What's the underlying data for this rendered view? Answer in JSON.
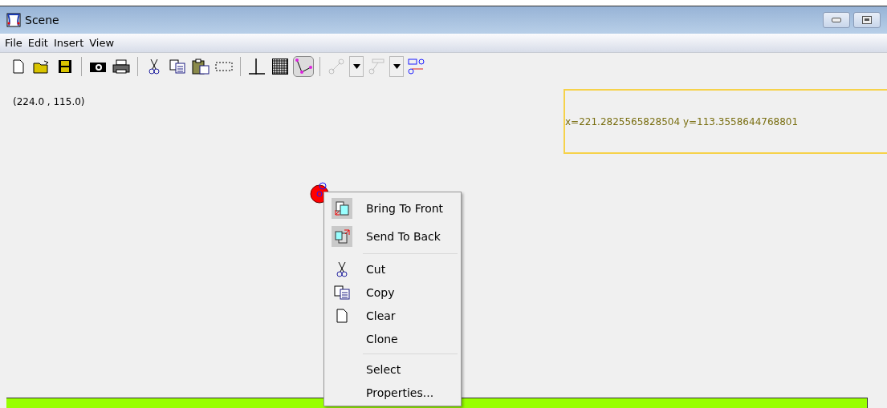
{
  "window": {
    "title": "Scene"
  },
  "menu": [
    "File",
    "Edit",
    "Insert",
    "View"
  ],
  "toolbar": [
    {
      "kind": "new",
      "selected": false,
      "disabled": false
    },
    {
      "kind": "open",
      "selected": false,
      "disabled": false
    },
    {
      "kind": "save",
      "selected": false,
      "disabled": false
    },
    {
      "kind": "sep"
    },
    {
      "kind": "camera",
      "selected": false,
      "disabled": false
    },
    {
      "kind": "print",
      "selected": false,
      "disabled": false
    },
    {
      "kind": "sep"
    },
    {
      "kind": "cut",
      "selected": false,
      "disabled": false
    },
    {
      "kind": "copy",
      "selected": false,
      "disabled": false
    },
    {
      "kind": "paste",
      "selected": false,
      "disabled": false
    },
    {
      "kind": "marquee",
      "selected": false,
      "disabled": false
    },
    {
      "kind": "sep"
    },
    {
      "kind": "axes",
      "selected": false,
      "disabled": false
    },
    {
      "kind": "grid",
      "selected": false,
      "disabled": false
    },
    {
      "kind": "curve",
      "selected": true,
      "disabled": false
    },
    {
      "kind": "sep"
    },
    {
      "kind": "segment",
      "selected": false,
      "disabled": true
    },
    {
      "kind": "dropdown",
      "selected": false,
      "disabled": false
    },
    {
      "kind": "flag",
      "selected": false,
      "disabled": true
    },
    {
      "kind": "dropdown",
      "selected": false,
      "disabled": false
    },
    {
      "kind": "nodes",
      "selected": false,
      "disabled": false
    }
  ],
  "canvas": {
    "coordinates": "(224.0 , 115.0)",
    "readout": "x=221.2825565828504 y=113.3558644768801"
  },
  "context_menu": {
    "groups": [
      [
        {
          "label": "Bring To Front",
          "kind": "front",
          "highlighted": true
        },
        {
          "label": "Send To Back",
          "kind": "back",
          "highlighted": true
        }
      ],
      [
        {
          "label": "Cut",
          "kind": "cut",
          "highlighted": false
        },
        {
          "label": "Copy",
          "kind": "copy",
          "highlighted": false
        },
        {
          "label": "Clear",
          "kind": "clear",
          "highlighted": false
        },
        {
          "label": "Clone",
          "kind": "plain",
          "highlighted": false
        }
      ],
      [
        {
          "label": "Select",
          "kind": "plain",
          "highlighted": false
        },
        {
          "label": "Properties...",
          "kind": "plain",
          "highlighted": false
        }
      ]
    ]
  }
}
